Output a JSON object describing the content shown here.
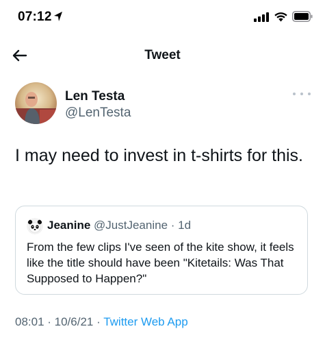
{
  "status_bar": {
    "time": "07:12"
  },
  "nav": {
    "title": "Tweet"
  },
  "tweet": {
    "author_name": "Len Testa",
    "author_handle": "@LenTesta",
    "text": "I may need to invest in t-shirts for this.",
    "timestamp": "08:01 · 10/6/21",
    "separator": " · ",
    "source": "Twitter Web App"
  },
  "quote": {
    "author_name": "Jeanine",
    "author_handle": "@JustJeanine",
    "time": "1d",
    "separator": " · ",
    "text": "From the few clips I've seen of the kite show, it feels like the title should have been \"Kitetails: Was That Supposed to Happen?\""
  },
  "colors": {
    "text_primary": "#0f1419",
    "text_secondary": "#536471",
    "accent": "#1d9bf0",
    "border": "#cfd9de"
  }
}
